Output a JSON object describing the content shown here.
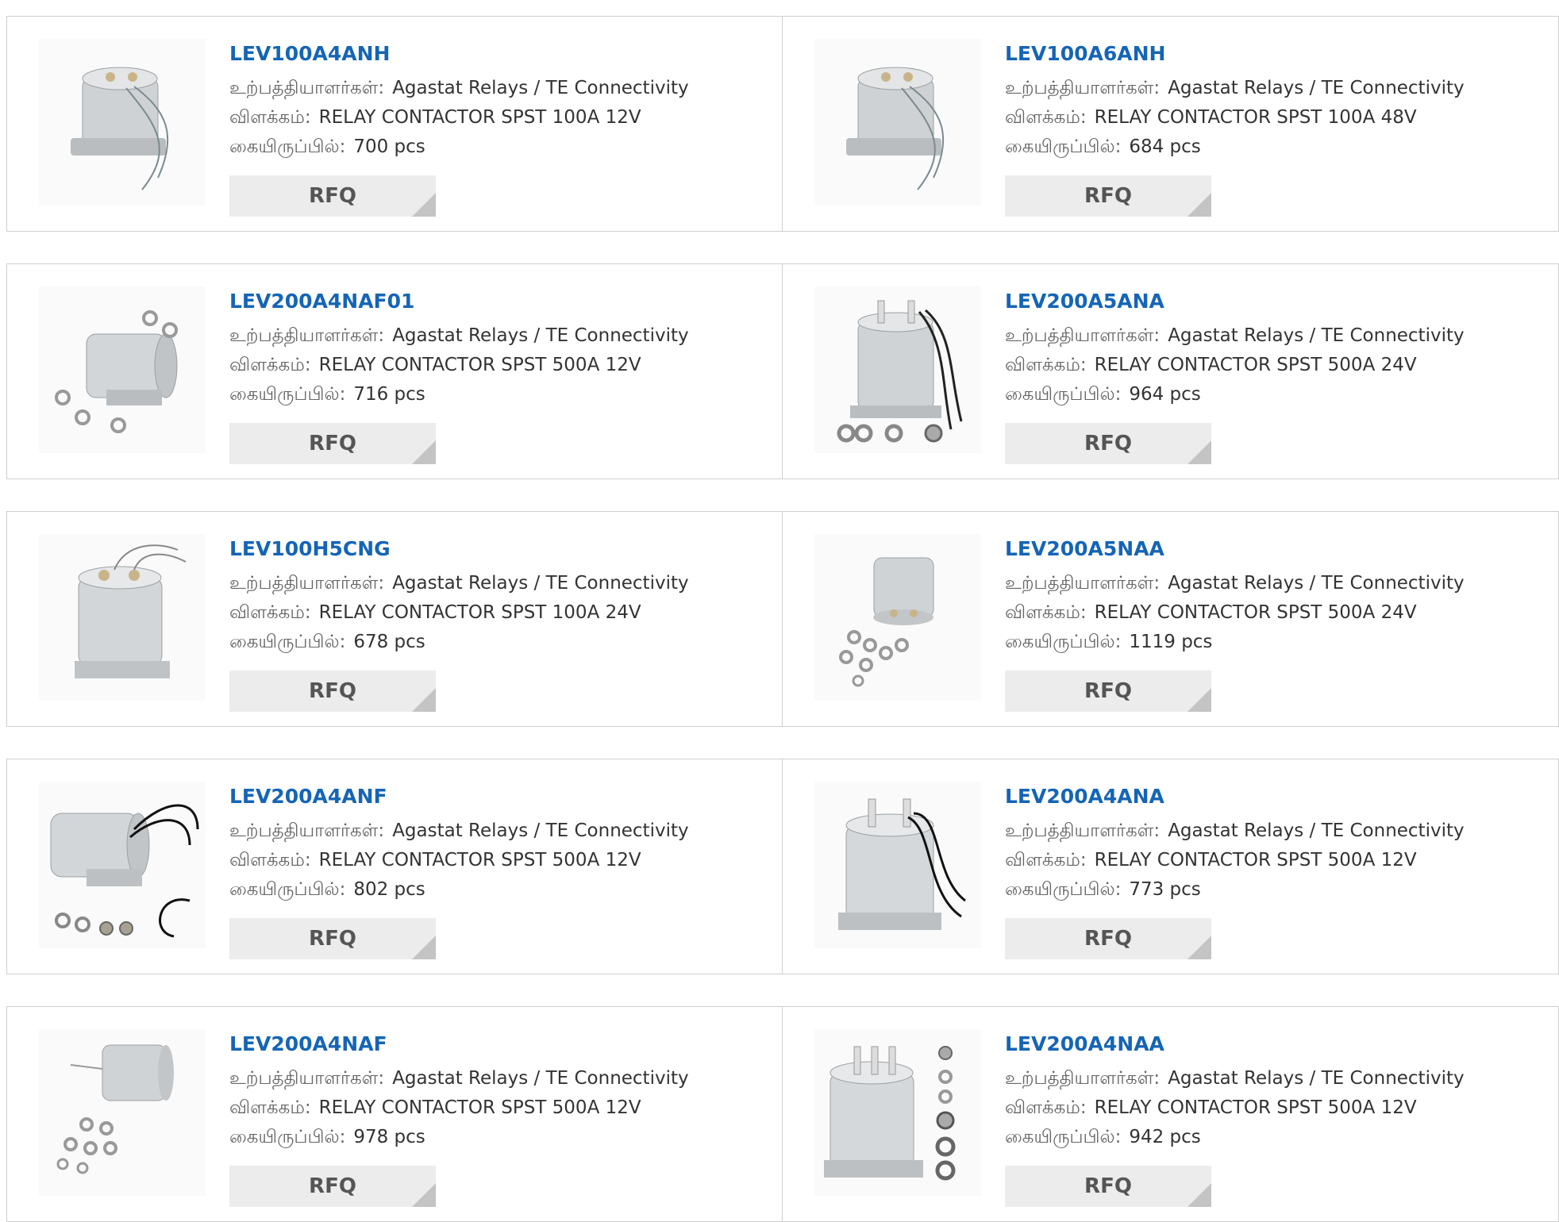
{
  "labels": {
    "manufacturer": "உற்பத்தியாளர்கள்:",
    "description": "விளக்கம்:",
    "stock": "கையிருப்பில்:",
    "rfq": "RFQ"
  },
  "products": [
    {
      "part": "LEV100A4ANH",
      "manufacturer": "Agastat Relays / TE Connectivity",
      "description": "RELAY CONTACTOR SPST 100A 12V",
      "stock": "700 pcs",
      "image_icon": "relay-contactor-image"
    },
    {
      "part": "LEV100A6ANH",
      "manufacturer": "Agastat Relays / TE Connectivity",
      "description": "RELAY CONTACTOR SPST 100A 48V",
      "stock": "684 pcs",
      "image_icon": "relay-contactor-image"
    },
    {
      "part": "LEV200A4NAF01",
      "manufacturer": "Agastat Relays / TE Connectivity",
      "description": "RELAY CONTACTOR SPST 500A 12V",
      "stock": "716 pcs",
      "image_icon": "relay-contactor-image"
    },
    {
      "part": "LEV200A5ANA",
      "manufacturer": "Agastat Relays / TE Connectivity",
      "description": "RELAY CONTACTOR SPST 500A 24V",
      "stock": "964 pcs",
      "image_icon": "relay-contactor-image"
    },
    {
      "part": "LEV100H5CNG",
      "manufacturer": "Agastat Relays / TE Connectivity",
      "description": "RELAY CONTACTOR SPST 100A 24V",
      "stock": "678 pcs",
      "image_icon": "relay-contactor-image"
    },
    {
      "part": "LEV200A5NAA",
      "manufacturer": "Agastat Relays / TE Connectivity",
      "description": "RELAY CONTACTOR SPST 500A 24V",
      "stock": "1119 pcs",
      "image_icon": "relay-contactor-image"
    },
    {
      "part": "LEV200A4ANF",
      "manufacturer": "Agastat Relays / TE Connectivity",
      "description": "RELAY CONTACTOR SPST 500A 12V",
      "stock": "802 pcs",
      "image_icon": "relay-contactor-image"
    },
    {
      "part": "LEV200A4ANA",
      "manufacturer": "Agastat Relays / TE Connectivity",
      "description": "RELAY CONTACTOR SPST 500A 12V",
      "stock": "773 pcs",
      "image_icon": "relay-contactor-image"
    },
    {
      "part": "LEV200A4NAF",
      "manufacturer": "Agastat Relays / TE Connectivity",
      "description": "RELAY CONTACTOR SPST 500A 12V",
      "stock": "978 pcs",
      "image_icon": "relay-contactor-image"
    },
    {
      "part": "LEV200A4NAA",
      "manufacturer": "Agastat Relays / TE Connectivity",
      "description": "RELAY CONTACTOR SPST 500A 12V",
      "stock": "942 pcs",
      "image_icon": "relay-contactor-image"
    }
  ],
  "colors": {
    "part_link": "#1565b6",
    "rfq_bg": "#ececec",
    "border": "#cfcfcf"
  }
}
